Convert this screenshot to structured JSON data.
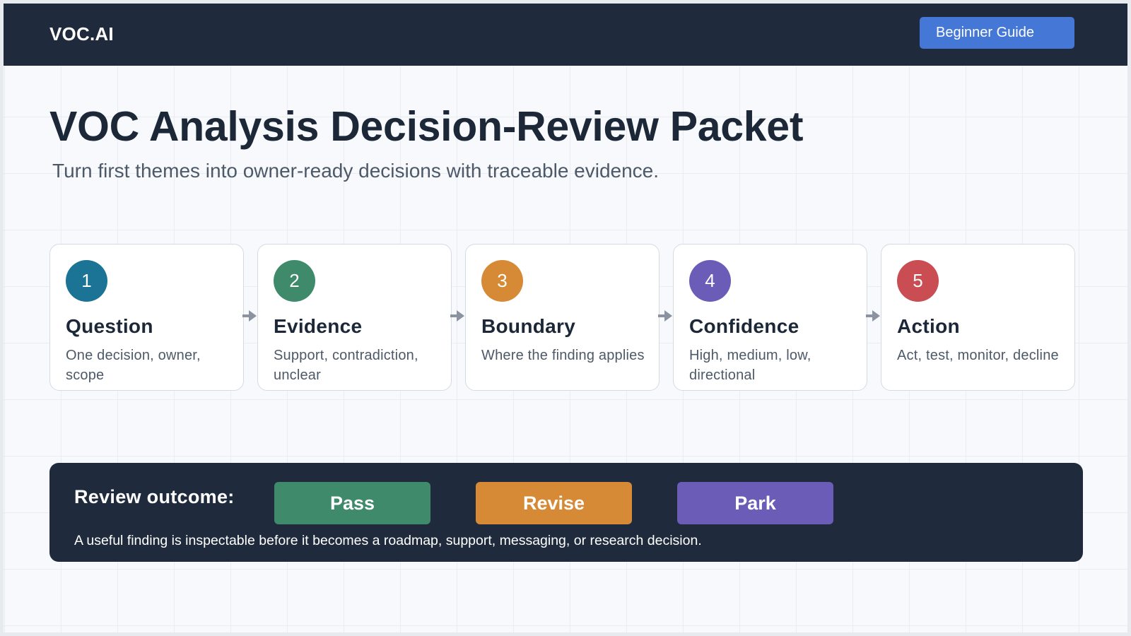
{
  "header": {
    "brand": "VOC.AI",
    "guide_button": "Beginner Guide"
  },
  "hero": {
    "title": "VOC Analysis Decision-Review Packet",
    "subtitle": "Turn first themes into owner-ready decisions with traceable evidence."
  },
  "steps": [
    {
      "number": "1",
      "title": "Question",
      "description": "One decision, owner, scope",
      "color": "#1b7396"
    },
    {
      "number": "2",
      "title": "Evidence",
      "description": "Support, contradiction, unclear",
      "color": "#3e8a6b"
    },
    {
      "number": "3",
      "title": "Boundary",
      "description": "Where the finding applies",
      "color": "#d68a36"
    },
    {
      "number": "4",
      "title": "Confidence",
      "description": "High, medium, low, directional",
      "color": "#6b5cb8"
    },
    {
      "number": "5",
      "title": "Action",
      "description": "Act, test, monitor, decline",
      "color": "#c94d52"
    }
  ],
  "outcome": {
    "label": "Review outcome:",
    "buttons": [
      {
        "label": "Pass",
        "color": "#3e8a6b"
      },
      {
        "label": "Revise",
        "color": "#d68a36"
      },
      {
        "label": "Park",
        "color": "#6b5cb8"
      }
    ],
    "note": "A useful finding is inspectable before it becomes a roadmap, support, messaging, or research decision."
  },
  "colors": {
    "header_bg": "#1f2b3d",
    "accent": "#4578d6",
    "page_bg": "#f7f9fc"
  }
}
